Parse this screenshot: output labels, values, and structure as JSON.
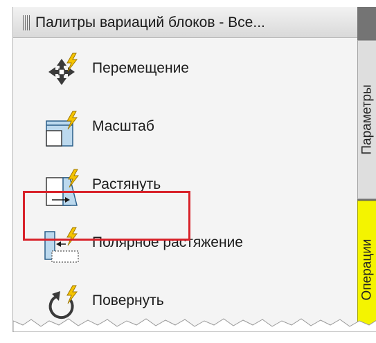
{
  "palette": {
    "title": "Палитры вариаций блоков - Все...",
    "tabs": [
      {
        "label": "Параметры",
        "color": "#dedede"
      },
      {
        "label": "Операции",
        "color": "#f4f400"
      }
    ],
    "tools": [
      {
        "label": "Перемещение",
        "icon": "move-action-icon"
      },
      {
        "label": "Масштаб",
        "icon": "scale-action-icon"
      },
      {
        "label": "Растянуть",
        "icon": "stretch-action-icon",
        "highlighted": true
      },
      {
        "label": "Полярное растяжение",
        "icon": "polar-stretch-action-icon"
      },
      {
        "label": "Повернуть",
        "icon": "rotate-action-icon"
      }
    ],
    "highlight_color": "#d8222a"
  }
}
